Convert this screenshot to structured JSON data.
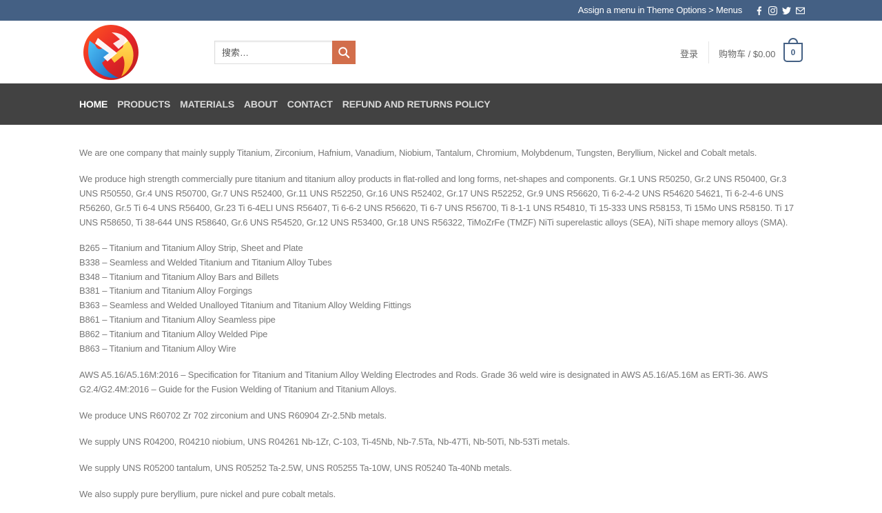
{
  "topbar": {
    "menu_text": "Assign a menu in Theme Options > Menus",
    "social_icons": [
      "facebook-icon",
      "instagram-icon",
      "twitter-icon",
      "email-icon"
    ]
  },
  "header": {
    "search_placeholder": "搜索…",
    "login_label": "登录",
    "cart_label": "购物车 / $0.00",
    "cart_count": "0"
  },
  "nav": {
    "items": [
      {
        "label": "HOME",
        "active": true
      },
      {
        "label": "PRODUCTS"
      },
      {
        "label": "MATERIALS"
      },
      {
        "label": "ABOUT"
      },
      {
        "label": "CONTACT"
      },
      {
        "label": "REFUND AND RETURNS POLICY"
      }
    ]
  },
  "content": {
    "intro": "We are one company that mainly supply Titanium, Zirconium, Hafnium, Vanadium, Niobium, Tantalum, Chromium, Molybdenum, Tungsten, Beryllium, Nickel and Cobalt metals.",
    "titanium": "We produce high strength commercially pure titanium and titanium alloy products in flat-rolled and long forms, net-shapes and components. Gr.1 UNS R50250, Gr.2 UNS R50400, Gr.3 UNS R50550, Gr.4 UNS R50700, Gr.7 UNS R52400, Gr.11 UNS R52250, Gr.16 UNS R52402, Gr.17 UNS R52252, Gr.9 UNS R56620, Ti 6-2-4-2 UNS R54620 54621, Ti 6-2-4-6 UNS R56260, Gr.5 Ti 6-4 UNS R56400, Gr.23 Ti 6-4ELI UNS R56407, Ti 6-6-2 UNS R56620, Ti 6-7 UNS R56700, Ti 8-1-1 UNS R54810, Ti 15-333 UNS R58153, Ti 15Mo UNS R58150. Ti 17 UNS R58650, Ti 38-644 UNS R58640, Gr.6 UNS R54520, Gr.12 UNS R53400, Gr.18 UNS R56322, TiMoZrFe (TMZF) NiTi superelastic alloys (SEA), NiTi shape memory alloys (SMA).",
    "standards": [
      "B265 – Titanium and Titanium Alloy Strip, Sheet and Plate",
      "B338 – Seamless and Welded Titanium and Titanium Alloy Tubes",
      "B348 – Titanium and Titanium Alloy Bars and Billets",
      "B381 – Titanium and Titanium Alloy Forgings",
      "B363 – Seamless and Welded Unalloyed Titanium and Titanium Alloy Welding Fittings",
      "B861 – Titanium and Titanium Alloy Seamless pipe",
      "B862 – Titanium and Titanium Alloy Welded Pipe",
      "B863 – Titanium and Titanium Alloy Wire"
    ],
    "aws": "AWS A5.16/A5.16M:2016 – Specification for Titanium and Titanium Alloy Welding Electrodes and Rods. Grade 36 weld wire is designated in AWS A5.16/A5.16M as ERTi-36. AWS G2.4/G2.4M:2016 – Guide for the Fusion Welding of Titanium and Titanium Alloys.",
    "zirconium": "We produce UNS R60702 Zr 702 zirconium and UNS R60904 Zr-2.5Nb metals.",
    "niobium": "We supply UNS R04200, R04210 niobium, UNS R04261 Nb-1Zr, C-103, Ti-45Nb, Nb-7.5Ta, Nb-47Ti, Nb-50Ti, Nb-53Ti metals.",
    "tantalum": "We supply UNS R05200 tantalum, UNS R05252 Ta-2.5W, UNS R05255 Ta-10W, UNS R05240 Ta-40Nb metals.",
    "beryllium": "We also supply pure beryllium, pure nickel and pure cobalt metals."
  },
  "colors": {
    "topbar": "#446084",
    "nav": "#424242",
    "search_button": "#d26e4b",
    "text": "#777777"
  }
}
